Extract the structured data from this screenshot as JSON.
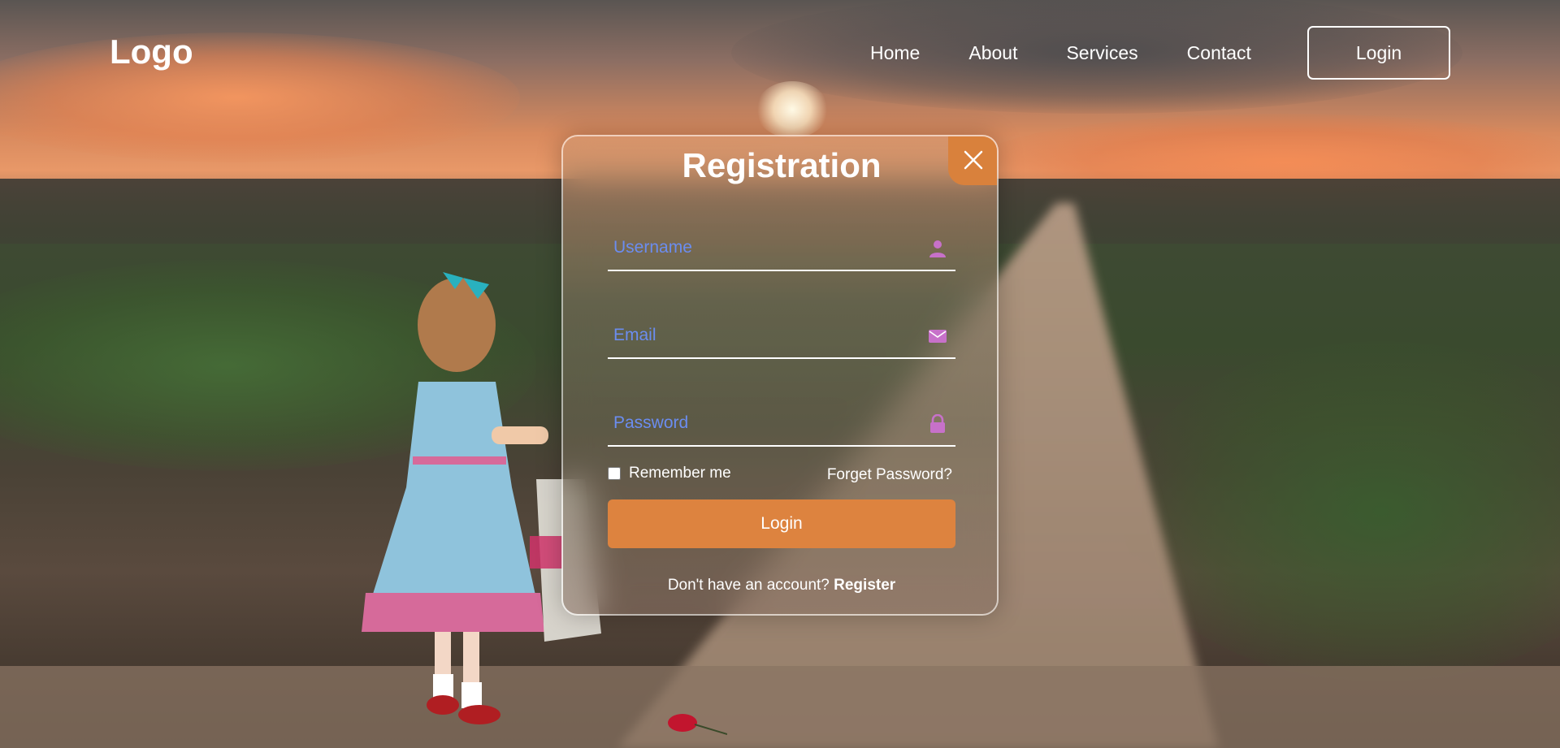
{
  "nav": {
    "logo": "Logo",
    "links": [
      "Home",
      "About",
      "Services",
      "Contact"
    ],
    "login_button": "Login"
  },
  "form": {
    "title": "Registration",
    "username_placeholder": "Username",
    "email_placeholder": "Email",
    "password_placeholder": "Password",
    "remember_label": "Remember me",
    "forgot_label": "Forget Password?",
    "login_button": "Login",
    "register_prompt": "Don't have an account?",
    "register_link": "Register",
    "icons": {
      "username": "person-icon",
      "email": "envelope-icon",
      "password": "lock-icon",
      "close": "close-icon"
    }
  },
  "colors": {
    "accent": "#dd833f",
    "placeholder": "#6b8df0",
    "field_icon": "#c771c9"
  }
}
